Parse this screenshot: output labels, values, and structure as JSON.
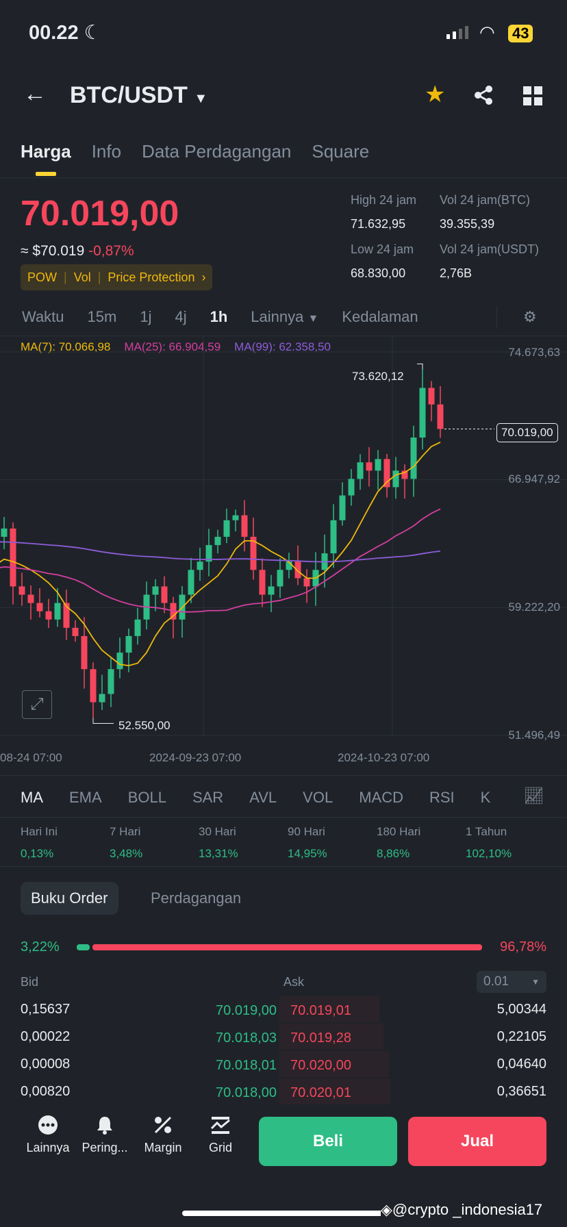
{
  "status": {
    "time": "00.22",
    "battery": "43"
  },
  "header": {
    "pair": "BTC/USDT"
  },
  "tabs": [
    "Harga",
    "Info",
    "Data Perdagangan",
    "Square"
  ],
  "price": {
    "last": "70.019,00",
    "usd": "≈ $70.019",
    "change": "-0,87%",
    "badges": [
      "POW",
      "Vol",
      "Price Protection"
    ]
  },
  "stats": [
    {
      "label": "High 24 jam",
      "value": "71.632,95"
    },
    {
      "label": "Vol 24 jam(BTC)",
      "value": "39.355,39"
    },
    {
      "label": "Low 24 jam",
      "value": "68.830,00"
    },
    {
      "label": "Vol 24 jam(USDT)",
      "value": "2,76B"
    }
  ],
  "intervals": [
    "Waktu",
    "15m",
    "1j",
    "4j",
    "1h",
    "Lainnya",
    "Kedalaman"
  ],
  "ma_legend": {
    "ma7": "MA(7): 70.066,98",
    "ma25": "MA(25): 66.904,59",
    "ma99": "MA(99): 62.358,50"
  },
  "colors": {
    "up": "#2ebd85",
    "down": "#f6465d",
    "ma7": "#f0b90b",
    "ma25": "#d63ea0",
    "ma99": "#8e5cd9"
  },
  "chart_data": {
    "type": "candlestick",
    "y_labels": [
      "74.673,63",
      "66.947,92",
      "59.222,20",
      "51.496,49"
    ],
    "ylim": [
      51496.49,
      74673.63
    ],
    "x_labels": [
      "08-24 07:00",
      "2024-09-23 07:00",
      "2024-10-23 07:00"
    ],
    "current_price_label": "70.019,00",
    "high_annotation": "73.620,12",
    "low_annotation": "52.550,00",
    "closes": [
      61500,
      63500,
      64000,
      60500,
      60000,
      59500,
      59000,
      58500,
      59500,
      58000,
      57500,
      55500,
      53500,
      54000,
      55500,
      56500,
      57500,
      58500,
      60000,
      60500,
      59500,
      58500,
      60000,
      61500,
      62000,
      63000,
      63500,
      64500,
      64800,
      63500,
      61500,
      60000,
      60500,
      61500,
      62000,
      61000,
      60500,
      61500,
      62500,
      64500,
      66000,
      67000,
      68000,
      67500,
      68200,
      66500,
      67500,
      67000,
      69500,
      72500,
      71500,
      70019
    ],
    "ma99_start": 63200
  },
  "indicators": [
    "MA",
    "EMA",
    "BOLL",
    "SAR",
    "AVL",
    "VOL",
    "MACD",
    "RSI",
    "K"
  ],
  "performance": [
    {
      "label": "Hari Ini",
      "value": "0,13%"
    },
    {
      "label": "7 Hari",
      "value": "3,48%"
    },
    {
      "label": "30 Hari",
      "value": "13,31%"
    },
    {
      "label": "90 Hari",
      "value": "14,95%"
    },
    {
      "label": "180 Hari",
      "value": "8,86%"
    },
    {
      "label": "1 Tahun",
      "value": "102,10%"
    }
  ],
  "orderbook": {
    "tabs": [
      "Buku Order",
      "Perdagangan"
    ],
    "bid_pct": "3,22%",
    "ask_pct": "96,78%",
    "bid_ratio": 3.22,
    "bid_label": "Bid",
    "ask_label": "Ask",
    "precision": "0.01",
    "rows": [
      {
        "bq": "0,15637",
        "bp": "70.019,00",
        "ap": "70.019,01",
        "aq": "5,00344"
      },
      {
        "bq": "0,00022",
        "bp": "70.018,03",
        "ap": "70.019,28",
        "aq": "0,22105"
      },
      {
        "bq": "0,00008",
        "bp": "70.018,01",
        "ap": "70.020,00",
        "aq": "0,04640"
      },
      {
        "bq": "0,00820",
        "bp": "70.018,00",
        "ap": "70.020,01",
        "aq": "0,36651"
      }
    ]
  },
  "bottom": {
    "items": [
      "Lainnya",
      "Pering...",
      "Margin",
      "Grid"
    ],
    "buy": "Beli",
    "sell": "Jual"
  },
  "watermark": "@crypto _indonesia17"
}
